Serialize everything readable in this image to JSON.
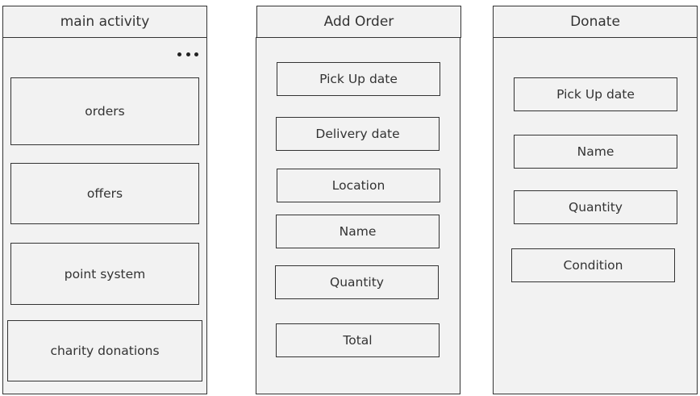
{
  "screens": [
    {
      "title": "main activity",
      "items": [
        "orders",
        "offers",
        "point system",
        "charity donations"
      ]
    },
    {
      "title": "Add Order",
      "items": [
        "Pick Up date",
        "Delivery date",
        "Location",
        "Name",
        "Quantity",
        "Total"
      ]
    },
    {
      "title": "Donate",
      "items": [
        "Pick Up date",
        "Name",
        "Quantity",
        "Condition"
      ]
    }
  ],
  "icons": {
    "overflow_menu": "more-horizontal-icon"
  }
}
